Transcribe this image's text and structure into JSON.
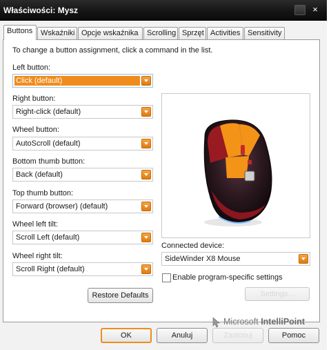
{
  "window": {
    "title": "Właściwości: Mysz",
    "close_glyph": "×"
  },
  "tabs": [
    "Buttons",
    "Wskaźniki",
    "Opcje wskaźnika",
    "Scrolling",
    "Sprzęt",
    "Activities",
    "Sensitivity"
  ],
  "instructions": "To change a button assignment, click a command in the list.",
  "buttons": {
    "left_label": "Left button:",
    "left_value": "Click (default)",
    "right_label": "Right button:",
    "right_value": "Right-click (default)",
    "wheel_label": "Wheel button:",
    "wheel_value": "AutoScroll (default)",
    "bottom_thumb_label": "Bottom thumb button:",
    "bottom_thumb_value": "Back (default)",
    "top_thumb_label": "Top thumb button:",
    "top_thumb_value": "Forward (browser) (default)",
    "wheel_left_label": "Wheel left tilt:",
    "wheel_left_value": "Scroll Left (default)",
    "wheel_right_label": "Wheel right tilt:",
    "wheel_right_value": "Scroll Right (default)"
  },
  "restore_defaults": "Restore Defaults",
  "device": {
    "label": "Connected device:",
    "value": "SideWinder X8 Mouse"
  },
  "program_specific": {
    "label": "Enable program-specific settings",
    "checked": false
  },
  "settings_button": "Settings...",
  "logo": {
    "brand": "Microsoft",
    "product": "IntelliPoint"
  },
  "footer": {
    "ok": "OK",
    "cancel": "Anuluj",
    "apply": "Zastosuj",
    "help": "Pomoc"
  },
  "colors": {
    "accent": "#f08c1c",
    "titlebar": "#141414",
    "highlight_text": "#ffffff"
  }
}
